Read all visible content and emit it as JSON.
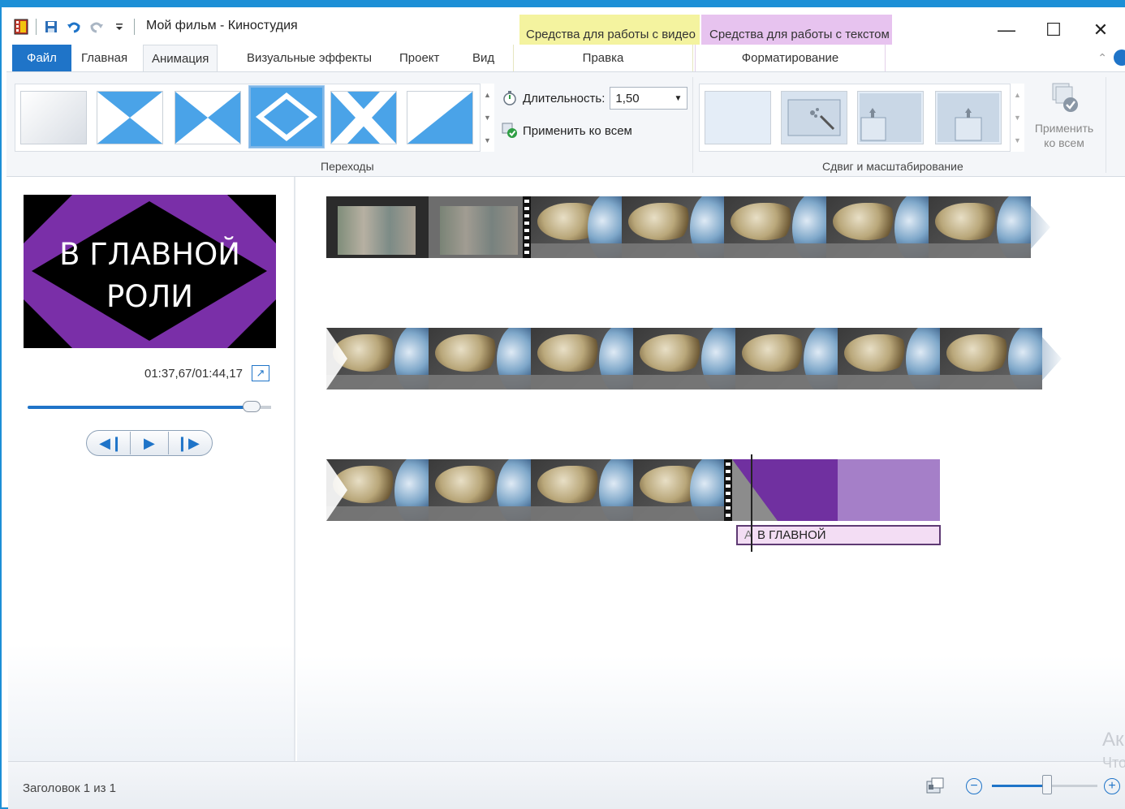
{
  "window": {
    "title": "Мой фильм - Киностудия",
    "ctx_video": "Средства для работы с видео",
    "ctx_text": "Средства для работы с текстом",
    "minimize": "—",
    "maximize": "☐",
    "close": "✕"
  },
  "tabs": {
    "file": "Файл",
    "items": [
      "Главная",
      "Анимация",
      "Визуальные эффекты",
      "Проект",
      "Вид"
    ],
    "active": "Анимация",
    "ctx_video_tab": "Правка",
    "ctx_text_tab": "Форматирование"
  },
  "ribbon": {
    "transitions_label": "Переходы",
    "duration_label": "Длительность:",
    "duration_value": "1,50",
    "apply_all": "Применить ко всем",
    "panzoom_label": "Сдвиг и масштабирование",
    "apply_all_2": "Применить ко всем"
  },
  "preview": {
    "title_text": "В ГЛАВНОЙ РОЛИ",
    "timecode": "01:37,67/01:44,17",
    "seek_fraction": 0.92
  },
  "storyboard": {
    "title_clip_label": "В ГЛАВНОЙ",
    "title_clip_prefix": "А"
  },
  "status": {
    "text": "Заголовок 1 из 1",
    "zoom_fraction": 0.52
  },
  "watermark": [
    "Ак",
    "Что"
  ],
  "colors": {
    "accent": "#1f74c8",
    "ctx_video_bg": "#f4f39f",
    "ctx_text_bg": "#e7c3ef",
    "title_clip": "#7030a0",
    "title_clip_light": "#a57fc8"
  }
}
